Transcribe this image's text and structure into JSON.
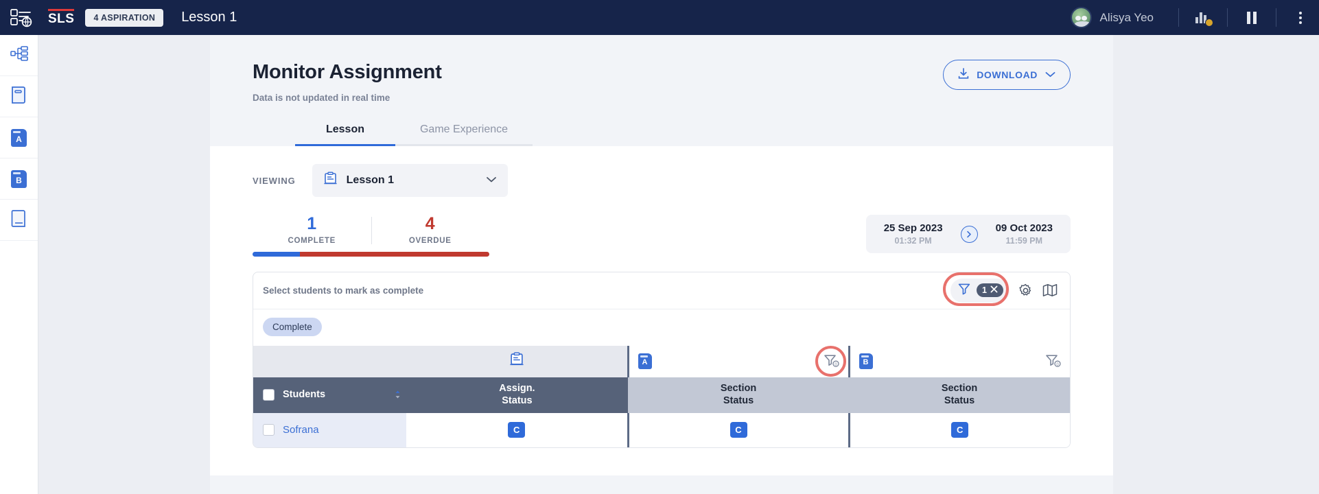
{
  "topbar": {
    "app_icon": "assignment-globe-icon",
    "logo": "SLS",
    "class_chip": "4 ASPIRATION",
    "lesson_title": "Lesson 1",
    "username": "Alisya Yeo",
    "avatar": "user-avatar",
    "stats_icon": "stats-coin-icon",
    "pause_icon": "pause-icon",
    "menu_icon": "kebab-menu-icon"
  },
  "rail": {
    "items": [
      {
        "name": "sitemap-icon",
        "label": ""
      },
      {
        "name": "book-icon",
        "label": ""
      },
      {
        "name": "folder-a-icon",
        "label": "A"
      },
      {
        "name": "folder-b-icon",
        "label": "B"
      },
      {
        "name": "notebook-icon",
        "label": ""
      }
    ]
  },
  "page": {
    "title": "Monitor Assignment",
    "subtitle": "Data is not updated in real time",
    "download_label": "DOWNLOAD",
    "download_icon": "download-icon",
    "download_chevron": "chevron-down-icon"
  },
  "tabs": [
    {
      "label": "Lesson",
      "active": true
    },
    {
      "label": "Game Experience",
      "active": false
    }
  ],
  "viewing": {
    "label": "VIEWING",
    "icon": "lesson-clipboard-icon",
    "value": "Lesson 1",
    "chevron": "chevron-down-icon"
  },
  "stats": {
    "complete": {
      "value": "1",
      "label": "COMPLETE"
    },
    "overdue": {
      "value": "4",
      "label": "OVERDUE"
    },
    "progress_complete_pct": 20,
    "progress_overdue_pct": 80
  },
  "date_range": {
    "start": {
      "date": "25 Sep 2023",
      "time": "01:32 PM"
    },
    "end": {
      "date": "09 Oct 2023",
      "time": "11:59 PM"
    },
    "arrow_icon": "chevron-right-circle-icon"
  },
  "toolbar": {
    "hint": "Select students to mark as complete",
    "filter_icon": "filter-icon",
    "filter_count": "1",
    "filter_clear_icon": "close-icon",
    "settings_icon": "gear-icon",
    "map_icon": "map-icon"
  },
  "chips": [
    {
      "label": "Complete"
    }
  ],
  "table": {
    "icon_row": {
      "assign_icon": "lesson-clipboard-icon",
      "section_a_icon": "folder-a-icon",
      "section_a_filter": "filter-zero-icon",
      "section_b_icon": "folder-b-icon",
      "section_b_filter": "filter-zero-icon"
    },
    "headers": {
      "students": "Students",
      "assign_status": "Assign.\nStatus",
      "assign_status_line1": "Assign.",
      "assign_status_line2": "Status",
      "section_status_line1": "Section",
      "section_status_line2": "Status"
    },
    "rows": [
      {
        "name": "Sofrana",
        "assign_status": "C",
        "section_a_status": "C",
        "section_b_status": "C"
      }
    ]
  },
  "colors": {
    "navy": "#16244a",
    "blue": "#2f6ad9",
    "red": "#c0392f",
    "highlight": "#e8716c",
    "header_slate": "#566279"
  }
}
